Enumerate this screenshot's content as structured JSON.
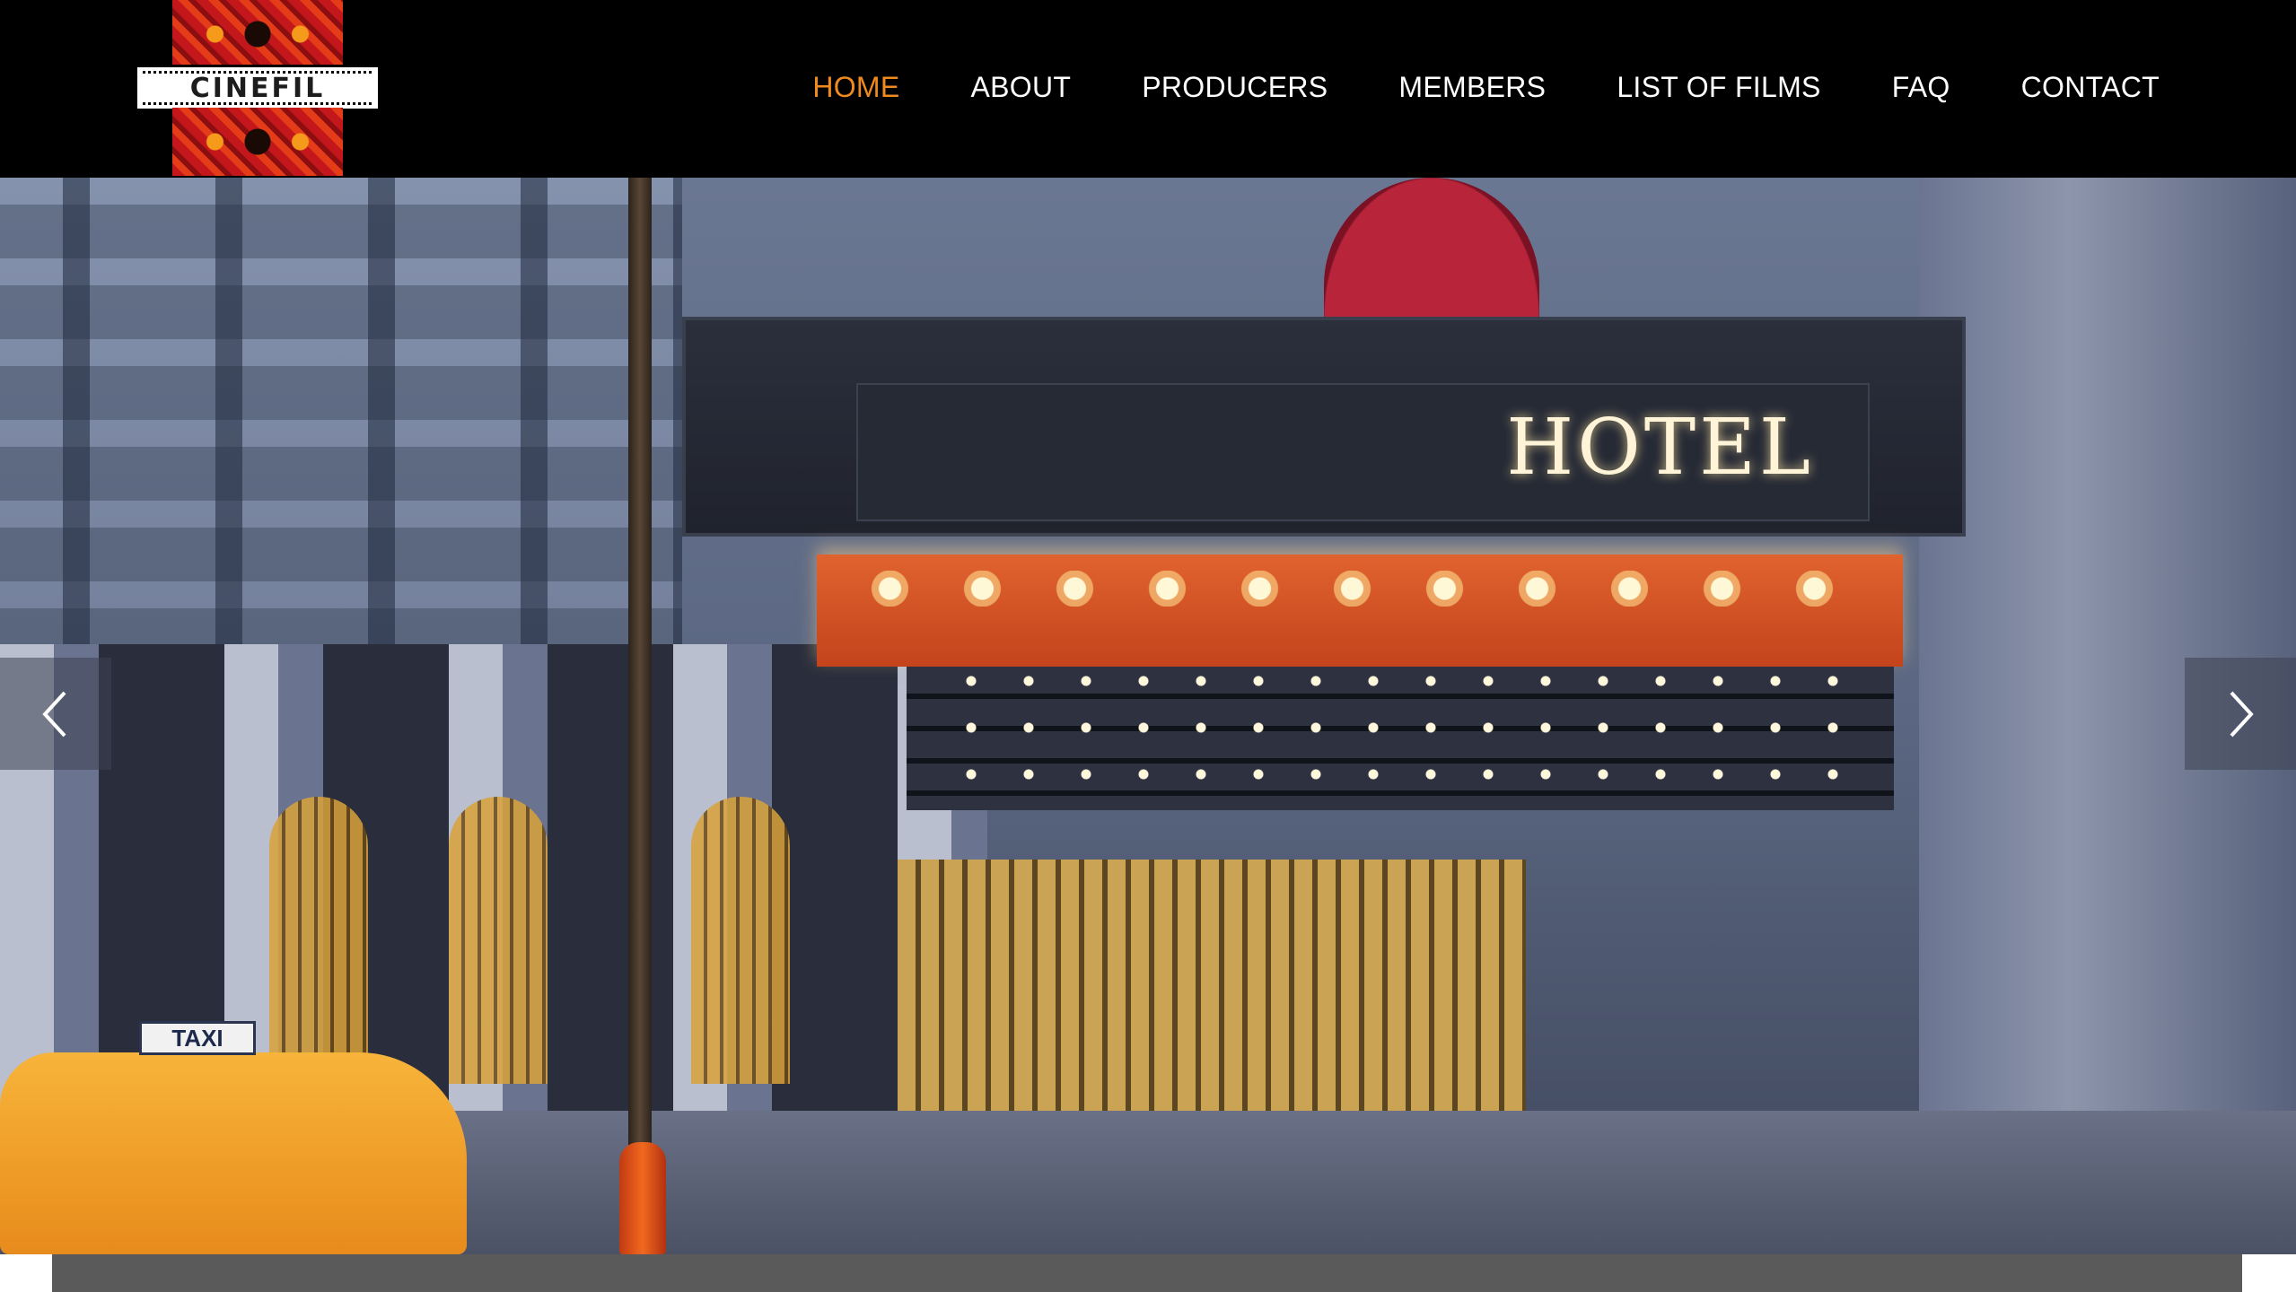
{
  "brand": {
    "logo_text": "CINEFIL"
  },
  "nav": {
    "items": [
      {
        "label": "HOME",
        "active": true
      },
      {
        "label": "ABOUT",
        "active": false
      },
      {
        "label": "PRODUCERS",
        "active": false
      },
      {
        "label": "MEMBERS",
        "active": false
      },
      {
        "label": "LIST OF FILMS",
        "active": false
      },
      {
        "label": "FAQ",
        "active": false
      },
      {
        "label": "CONTACT",
        "active": false
      }
    ],
    "active_color": "#f08a1e",
    "text_color": "#ffffff"
  },
  "hero": {
    "marquee_sign": "HOTEL",
    "taxi_sign": "TAXI",
    "prev_icon": "chevron-left-icon",
    "next_icon": "chevron-right-icon"
  },
  "colors": {
    "header_bg": "#000000",
    "bottom_bar": "#5a5a5a"
  }
}
